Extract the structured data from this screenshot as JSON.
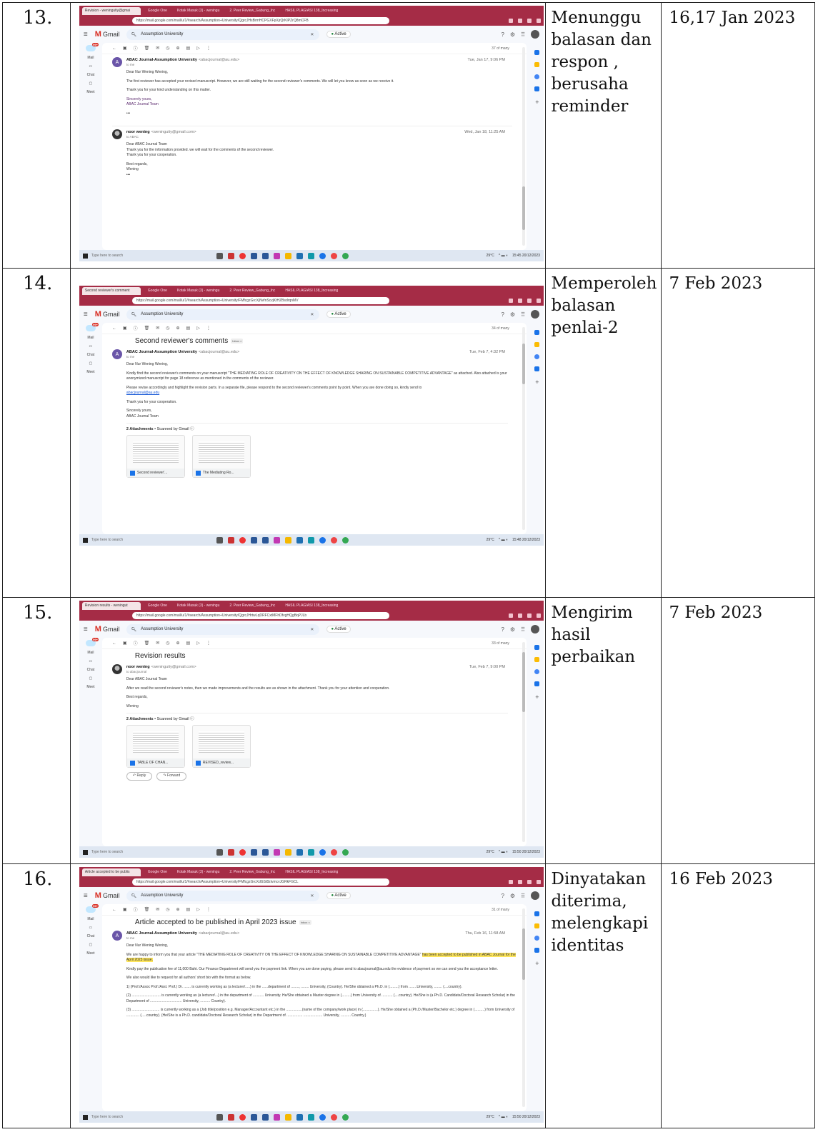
{
  "rows": [
    {
      "num": "13.",
      "activity": "Menunggu balasan dan respon , berusaha reminder",
      "date": "16,17 Jan 2023",
      "shot": {
        "tab_title": "Revision - weningutiy@gmai",
        "tabs": [
          "Google One",
          "Kotak Masuk (3) - weningu",
          "2. Peer Review_Gabung_Inc",
          "HASIL PLAGIASI 138_Increasing"
        ],
        "url": "https://mail.google.com/mail/u/1/#search/Assumption+University/QgrcJHsBrmHCPGXFpXjrQrKIPZrQ8mCFB",
        "search": "Assumption University",
        "count": "37 of many",
        "messages": [
          {
            "from": "ABAC Journal-Assumption University",
            "email": "<abacjournal@au.edu>",
            "to": "to me",
            "time": "Tue, Jan 17, 9:06 PM",
            "avatar": "A",
            "body": [
              "Dear Nur Wening Wening,",
              "The first reviewer has accepted your revised manuscript. However, we are still waiting for the second reviewer's comments. We will let you know as soon as we receive it.",
              "Thank you for your kind understanding on this matter."
            ],
            "sig": [
              "Sincerely yours,",
              "ABAC Journal Team"
            ]
          },
          {
            "from": "noor wening",
            "email": "<weningutiy@gmail.com>",
            "to": "to ABAC",
            "time": "Wed, Jan 18, 11:25 AM",
            "body": [
              "Dear ABAC Journal Team",
              "Thank you for the information provided. we will wait for the comments of the second reviewer.",
              "Thank you for your cooperation.",
              "Best regards,",
              "Wening"
            ]
          }
        ]
      }
    },
    {
      "num": "14.",
      "activity": "Memperoleh balasan penlai-2",
      "date": "7 Feb 2023",
      "shot": {
        "tab_title": "Second reviewer's comment",
        "url": "https://mail.google.com/mail/u/1/#search/Assumption+University/FMfcgzGrcXjNvfnScvjKtHZBsdrqnMV",
        "search": "Assumption University",
        "count": "34 of many",
        "subject": "Second reviewer's comments",
        "badge": "Inbox ×",
        "from": "ABAC Journal-Assumption University",
        "email": "<abacjournal@au.edu>",
        "to": "to me",
        "time": "Tue, Feb 7, 4:32 PM",
        "avatar": "A",
        "body": [
          "Dear Nur Wening Wening,",
          "Kindly find the second reviewer's comments on your manuscript \"THE MEDIATING ROLE OF CREATIVITY ON THE EFFECT OF KNOWLEDGE SHARING ON SUSTAINABLE COMPETITIVE ADVANTAGE\" as attached. Also attached is your anonymized manuscript for page 18 reference as mentioned in the comments of the reviewer.",
          "Please revise accordingly and highlight the revision parts. In a separate file, please respond to the second reviewer's comments point by point. When you are done doing so, kindly send to",
          "abacjournal@au.edu",
          "Thank you for your cooperation.",
          "Sincerely yours,",
          "ABAC Journal Team"
        ],
        "attach_label": "2 Attachments",
        "scanned": "• Scanned by Gmail ⓘ",
        "files": [
          "Second reviewer'...",
          "The Mediating Ro..."
        ]
      }
    },
    {
      "num": "15.",
      "activity": "Mengirim hasil perbaikan",
      "date": "7 Feb 2023",
      "shot": {
        "tab_title": "Revision results - weningut",
        "url": "https://mail.google.com/mail/u/1/#search/Assumption+University/QgrcJHrtwLqDRFCxtMFhDfvgHQgBqPJLb",
        "search": "Assumption University",
        "count": "33 of many",
        "subject": "Revision results",
        "badge": "Inbox ×",
        "from": "noor wening",
        "email": "<weningutiy@gmail.com>",
        "to": "to abacjournal",
        "time": "Tue, Feb 7, 9:00 PM",
        "body": [
          "Dear ABAC Journal Team",
          "After we read the second reviewer's notes, then we made improvements and the results are as shown in the attachment. Thank you for your attention and cooperation.",
          "Best regards,",
          "Wening"
        ],
        "attach_label": "2 Attachments",
        "scanned": "• Scanned by Gmail ⓘ",
        "files": [
          "TABLE OF CHAN...",
          "REVISED_review..."
        ],
        "reply": "Reply",
        "forward": "Forward"
      }
    },
    {
      "num": "16.",
      "activity": "Dinyatakan diterima, melengkapi identitas",
      "date": "16 Feb 2023",
      "shot": {
        "tab_title": "Article accepted to be publis",
        "url": "https://mail.google.com/mail/u/1/#search/Assumption+University/FMfcgzGrcXdGSt8ztvmcvJGRkFGCL",
        "search": "Assumption University",
        "count": "31 of many",
        "subject": "Article accepted to be published in April 2023 issue",
        "badge": "Inbox ×",
        "from": "ABAC Journal-Assumption University",
        "email": "<abacjournal@au.edu>",
        "to": "to me",
        "time": "Thu, Feb 16, 11:58 AM",
        "avatar": "A",
        "greeting": "Dear Nur Wening Wening,",
        "p1_a": "We are happy to inform you that your article \"THE MEDIATING ROLE OF CREATIVITY ON THE EFFECT OF KNOWLEDGE SHARING ON SUSTAINABLE COMPETITIVE ADVANTAGE\"",
        "p1_b": "has been accepted to be published in ABAC Journal for the April 2023 issue.",
        "p2": "Kindly pay the publication fee of 11,000 Baht. Our Finance Department will send you the payment link. When you are done paying, please send to abacjournal@au.edu the evidence of payment so we can send you the acceptance letter.",
        "p3": "We also would like to request for all authors' short bio with the format as below.",
        "p4": "1) (Prof./Assoc Prof./Asst. Prof.) Dr. ....... is currently working as (a lecturer/.....) in the ......department of ........, ........ University, (Country). He/She obtained a Ph.D. in (.........) from ........University, ........ (....country).",
        "p5": "(2) ............................. is currently working as (a lecturer/...) in the department of ........... University. He/She obtained a Master degree in (.........) from University of ........... (....country). He/She is (a Ph.D. Candidate/Doctoral Research Scholar) in the Department of ................................ University, .......... Country).",
        "p6": "(3) ............................ is currently working as a (Job title/position e.g. Manager/Accountant etc.) in the ................(name of the company/work place) in (...............). He/She obtained a (Ph.D./Master/Bachelor etc.) degree in (..........) from University of ............. (.....country). (He/She is a Ph.D. candidate/Doctoral Research Scholar) in the Department of ................ ................... University, .......... Country.)"
      }
    }
  ],
  "common": {
    "gmail": "Gmail",
    "status": "Active",
    "rail_mail": "Mail",
    "rail_chat": "Chat",
    "rail_meet": "Meet",
    "badge": "99+",
    "taskbar_search": "Type here to search",
    "weather": "29°C",
    "times": [
      "15:45",
      "15:48",
      "15:50",
      "15:50"
    ],
    "tray_date": "20/12/2023"
  }
}
